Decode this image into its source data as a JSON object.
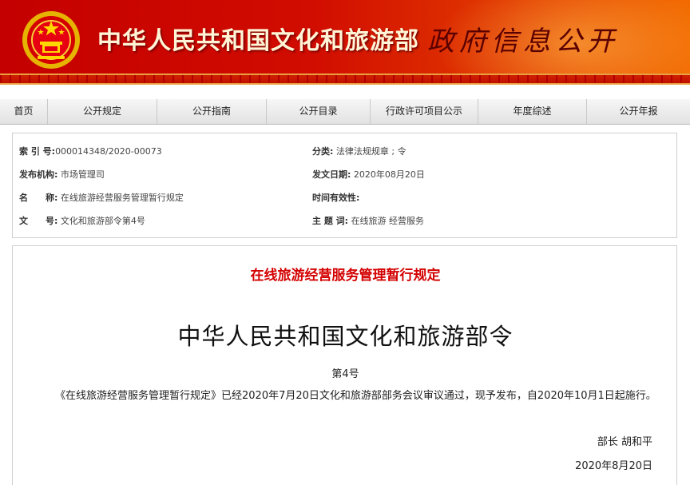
{
  "banner": {
    "ministry_name": "中华人民共和国文化和旅游部",
    "section_title": "政府信息公开"
  },
  "nav": {
    "items": [
      "首页",
      "公开规定",
      "公开指南",
      "公开目录",
      "行政许可项目公示",
      "年度综述",
      "公开年报"
    ]
  },
  "meta": {
    "index_label": "索 引 号:",
    "index_value": "000014348/2020-00073",
    "category_label": "分类:",
    "category_value": "法律法规规章 ; 令",
    "issuer_label": "发布机构:",
    "issuer_value": "市场管理司",
    "date_label": "发文日期:",
    "date_value": "2020年08月20日",
    "name_label": "名　　称:",
    "name_value": "在线旅游经营服务管理暂行规定",
    "validity_label": "时间有效性:",
    "validity_value": "",
    "docno_label": "文　　号:",
    "docno_value": "文化和旅游部令第4号",
    "subject_label": "主 题 词:",
    "subject_value": "在线旅游 经营服务"
  },
  "document": {
    "title": "在线旅游经营服务管理暂行规定",
    "order_title": "中华人民共和国文化和旅游部令",
    "order_no": "第4号",
    "body": "《在线旅游经营服务管理暂行规定》已经2020年7月20日文化和旅游部部务会议审议通过，现予发布，自2020年10月1日起施行。",
    "signatory": "部长  胡和平",
    "sign_date": "2020年8月20日"
  },
  "colors": {
    "banner_red": "#c40000",
    "title_red": "#d40000"
  }
}
